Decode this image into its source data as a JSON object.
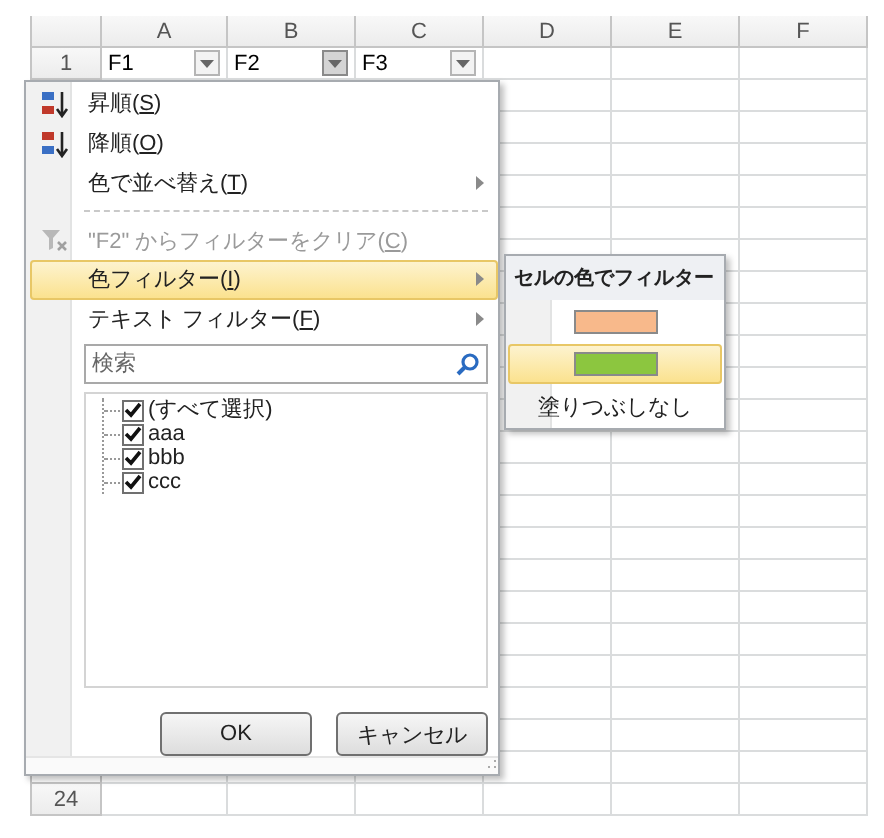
{
  "sheet": {
    "columns": [
      "A",
      "B",
      "C",
      "D",
      "E",
      "F"
    ],
    "rows": [
      {
        "number": "1",
        "cells": [
          {
            "text": "F1",
            "filter_button": true,
            "pressed": false
          },
          {
            "text": "F2",
            "filter_button": true,
            "pressed": true
          },
          {
            "text": "F3",
            "filter_button": true,
            "pressed": false
          }
        ]
      },
      {
        "number": "24"
      }
    ]
  },
  "filter_menu": {
    "items": [
      {
        "kind": "sort-ascending",
        "before": "昇順(",
        "key": "S",
        "after": ")",
        "disabled": false,
        "selected": false,
        "has_submenu": false
      },
      {
        "kind": "sort-descending",
        "before": "降順(",
        "key": "O",
        "after": ")",
        "disabled": false,
        "selected": false,
        "has_submenu": false
      },
      {
        "kind": "plain",
        "before": "色で並べ替え(",
        "key": "T",
        "after": ")",
        "disabled": false,
        "selected": false,
        "has_submenu": true
      },
      {
        "kind": "separator"
      },
      {
        "kind": "clear-filter",
        "before": "\"F2\" からフィルターをクリア(",
        "key": "C",
        "after": ")",
        "disabled": true,
        "selected": false,
        "has_submenu": false
      },
      {
        "kind": "plain",
        "before": "色フィルター(",
        "key": "I",
        "after": ")",
        "disabled": false,
        "selected": true,
        "has_submenu": true
      },
      {
        "kind": "plain",
        "before": "テキスト フィルター(",
        "key": "F",
        "after": ")",
        "disabled": false,
        "selected": false,
        "has_submenu": true
      }
    ],
    "search": {
      "placeholder": "検索"
    },
    "values": [
      {
        "label": "(すべて選択)",
        "checked": true
      },
      {
        "label": "aaa",
        "checked": true
      },
      {
        "label": "bbb",
        "checked": true
      },
      {
        "label": "ccc",
        "checked": true
      }
    ],
    "buttons": [
      "OK",
      "キャンセル"
    ]
  },
  "color_submenu": {
    "title": "セルの色でフィルター",
    "options": [
      {
        "kind": "swatch",
        "color": "#f8b98b",
        "selected": false
      },
      {
        "kind": "swatch",
        "color": "#8cc63f",
        "selected": true
      },
      {
        "kind": "text",
        "label": "塗りつぶしなし",
        "selected": false
      }
    ]
  }
}
